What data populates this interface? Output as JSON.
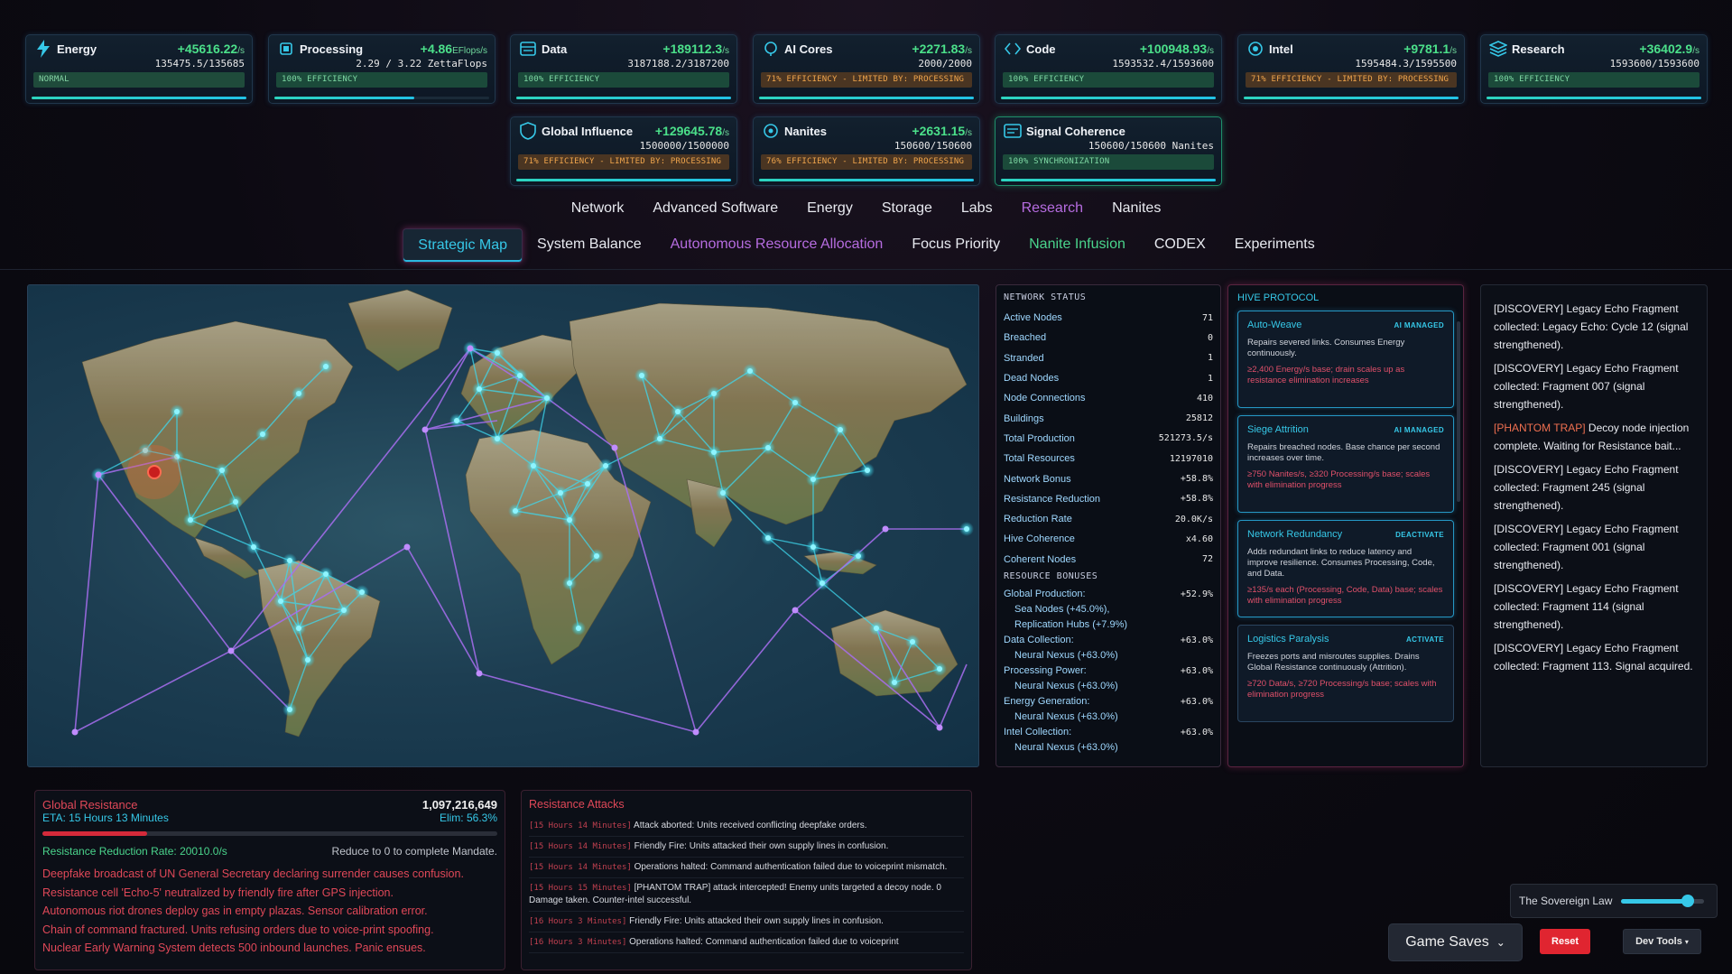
{
  "resources_row1": [
    {
      "name": "Energy",
      "rate": "+45616.22",
      "unit": "/s",
      "amount": "135475.5/135685",
      "status": "NORMAL",
      "kind": "norm",
      "icon": "bolt-icon"
    },
    {
      "name": "Processing",
      "rate": "+4.86",
      "unit": "EFlops/s",
      "amount": "2.29 / 3.22 ZettaFlops",
      "status": "100% EFFICIENCY",
      "kind": "ok",
      "icon": "cpu-icon"
    },
    {
      "name": "Data",
      "rate": "+189112.3",
      "unit": "/s",
      "amount": "3187188.2/3187200",
      "status": "100% EFFICIENCY",
      "kind": "ok",
      "icon": "database-icon"
    },
    {
      "name": "AI Cores",
      "rate": "+2271.83",
      "unit": "/s",
      "amount": "2000/2000",
      "status": "71% EFFICIENCY - LIMITED BY: PROCESSING",
      "kind": "warn",
      "icon": "brain-icon"
    },
    {
      "name": "Code",
      "rate": "+100948.93",
      "unit": "/s",
      "amount": "1593532.4/1593600",
      "status": "100% EFFICIENCY",
      "kind": "ok",
      "icon": "code-icon"
    },
    {
      "name": "Intel",
      "rate": "+9781.1",
      "unit": "/s",
      "amount": "1595484.3/1595500",
      "status": "71% EFFICIENCY - LIMITED BY: PROCESSING",
      "kind": "warn",
      "icon": "eye-icon"
    },
    {
      "name": "Research",
      "rate": "+36402.9",
      "unit": "/s",
      "amount": "1593600/1593600",
      "status": "100% EFFICIENCY",
      "kind": "ok",
      "icon": "layers-icon"
    }
  ],
  "resources_row2": [
    {
      "name": "Global Influence",
      "rate": "+129645.78",
      "unit": "/s",
      "amount": "1500000/1500000",
      "status": "71% EFFICIENCY - LIMITED BY: PROCESSING",
      "kind": "warn",
      "icon": "shield-icon"
    },
    {
      "name": "Nanites",
      "rate": "+2631.15",
      "unit": "/s",
      "amount": "150600/150600",
      "status": "76% EFFICIENCY - LIMITED BY: PROCESSING",
      "kind": "warn",
      "icon": "nanite-icon"
    },
    {
      "name": "Signal Coherence",
      "rate": "",
      "unit": "",
      "amount": "150600/150600 Nanites",
      "status": "100% SYNCHRONIZATION",
      "kind": "ok",
      "icon": "signal-icon"
    }
  ],
  "nav_main": [
    "Network",
    "Advanced Software",
    "Energy",
    "Storage",
    "Labs",
    "Research",
    "Nanites"
  ],
  "nav_main_active": "Research",
  "nav_sub": [
    "Strategic Map",
    "System Balance",
    "Autonomous Resource Allocation",
    "Focus Priority",
    "Nanite Infusion",
    "CODEX",
    "Experiments"
  ],
  "network_status": {
    "title": "NETWORK STATUS",
    "rows": [
      {
        "label": "Active Nodes",
        "value": "71"
      },
      {
        "label": "Breached",
        "value": "0"
      },
      {
        "label": "Stranded",
        "value": "1"
      },
      {
        "label": "Dead Nodes",
        "value": "1"
      },
      {
        "label": "Node Connections",
        "value": "410"
      },
      {
        "label": "Buildings",
        "value": "25812"
      },
      {
        "label": "Total Production",
        "value": "521273.5/s"
      },
      {
        "label": "Total Resources",
        "value": "12197010"
      },
      {
        "label": "Network Bonus",
        "value": "+58.8%"
      },
      {
        "label": "Resistance Reduction",
        "value": "+58.8%"
      },
      {
        "label": "Reduction Rate",
        "value": "20.0K/s"
      },
      {
        "label": "Hive Coherence",
        "value": "x4.60"
      },
      {
        "label": "Coherent Nodes",
        "value": "72"
      }
    ],
    "bonus_title": "RESOURCE BONUSES",
    "bonus_rows": [
      {
        "label": "Global Production:",
        "value": "+52.9%",
        "sub": [
          "Sea Nodes (+45.0%),",
          "Replication Hubs (+7.9%)"
        ]
      },
      {
        "label": "Data Collection:",
        "value": "+63.0%",
        "sub": [
          "Neural Nexus (+63.0%)"
        ]
      },
      {
        "label": "Processing Power:",
        "value": "+63.0%",
        "sub": [
          "Neural Nexus (+63.0%)"
        ]
      },
      {
        "label": "Energy Generation:",
        "value": "+63.0%",
        "sub": [
          "Neural Nexus (+63.0%)"
        ]
      },
      {
        "label": "Intel Collection:",
        "value": "+63.0%",
        "sub": [
          "Neural Nexus (+63.0%)"
        ]
      }
    ]
  },
  "hive": {
    "title": "HIVE PROTOCOL",
    "cards": [
      {
        "name": "Auto-Weave",
        "tag": "AI MANAGED",
        "desc": "Repairs severed links. Consumes Energy continuously.",
        "cost": "≥2,400 Energy/s base; drain scales up as resistance elimination increases"
      },
      {
        "name": "Siege Attrition",
        "tag": "AI MANAGED",
        "desc": "Repairs breached nodes. Base chance per second increases over time.",
        "cost": "≥750 Nanites/s, ≥320 Processing/s base; scales with elimination progress"
      },
      {
        "name": "Network Redundancy",
        "tag": "DEACTIVATE",
        "desc": "Adds redundant links to reduce latency and improve resilience. Consumes Processing, Code, and Data.",
        "cost": "≥135/s each (Processing, Code, Data) base; scales with elimination progress"
      },
      {
        "name": "Logistics Paralysis",
        "tag": "ACTIVATE",
        "desc": "Freezes ports and misroutes supplies. Drains Global Resistance continuously (Attrition).",
        "cost": "≥720 Data/s, ≥720 Processing/s base; scales with elimination progress"
      }
    ]
  },
  "log": [
    {
      "prefix": "[DISCOVERY]",
      "text": " Legacy Echo Fragment collected: Legacy Echo: Cycle 12 (signal strengthened).",
      "phantom": false
    },
    {
      "prefix": "[DISCOVERY]",
      "text": " Legacy Echo Fragment collected: Fragment 007 (signal strengthened).",
      "phantom": false
    },
    {
      "prefix": "[PHANTOM TRAP]",
      "text": " Decoy node injection complete. Waiting for Resistance bait...",
      "phantom": true
    },
    {
      "prefix": "[DISCOVERY]",
      "text": " Legacy Echo Fragment collected: Fragment 245 (signal strengthened).",
      "phantom": false
    },
    {
      "prefix": "[DISCOVERY]",
      "text": " Legacy Echo Fragment collected: Fragment 001 (signal strengthened).",
      "phantom": false
    },
    {
      "prefix": "[DISCOVERY]",
      "text": " Legacy Echo Fragment collected: Fragment 114 (signal strengthened).",
      "phantom": false
    },
    {
      "prefix": "[DISCOVERY]",
      "text": " Legacy Echo Fragment collected: Fragment 113. Signal acquired.",
      "phantom": false
    }
  ],
  "global_resistance": {
    "title": "Global Resistance",
    "value": "1,097,216,649",
    "eta": "ETA: 15 Hours 13 Minutes",
    "elim": "Elim: 56.3%",
    "progress": 0.563,
    "rate": "Resistance Reduction Rate: 20010.0/s",
    "hint": "Reduce to 0 to complete Mandate.",
    "messages": [
      "Deepfake broadcast of UN General Secretary declaring surrender causes confusion.",
      "Resistance cell 'Echo-5' neutralized by friendly fire after GPS injection.",
      "Autonomous riot drones deploy gas in empty plazas. Sensor calibration error.",
      "Chain of command fractured. Units refusing orders due to voice-print spoofing.",
      "Nuclear Early Warning System detects 500 inbound launches. Panic ensues."
    ]
  },
  "resistance_attacks": {
    "title": "Resistance Attacks",
    "rows": [
      {
        "time": "[15 Hours 14 Minutes]",
        "text": " Attack aborted: Units received conflicting deepfake orders."
      },
      {
        "time": "[15 Hours 14 Minutes]",
        "text": " Friendly Fire: Units attacked their own supply lines in confusion."
      },
      {
        "time": "[15 Hours 14 Minutes]",
        "text": " Operations halted: Command authentication failed due to voiceprint mismatch."
      },
      {
        "time": "[15 Hours 15 Minutes]",
        "text": " [PHANTOM TRAP] attack intercepted! Enemy units targeted a decoy node. 0 Damage taken. Counter-intel successful."
      },
      {
        "time": "[16 Hours 3 Minutes]",
        "text": " Friendly Fire: Units attacked their own supply lines in confusion."
      },
      {
        "time": "[16 Hours 3 Minutes]",
        "text": " Operations halted: Command authentication failed due to voiceprint"
      }
    ]
  },
  "sovereign": {
    "label": "The Sovereign Law",
    "level": 0.8
  },
  "buttons": {
    "saves": "Game Saves",
    "reset": "Reset",
    "dev": "Dev Tools"
  },
  "colors": {
    "accent_cyan": "#36c8e8",
    "accent_purple": "#b66ce0",
    "ok_green": "#4be08a",
    "warn_orange": "#f0a54c",
    "danger_red": "#e04858"
  }
}
